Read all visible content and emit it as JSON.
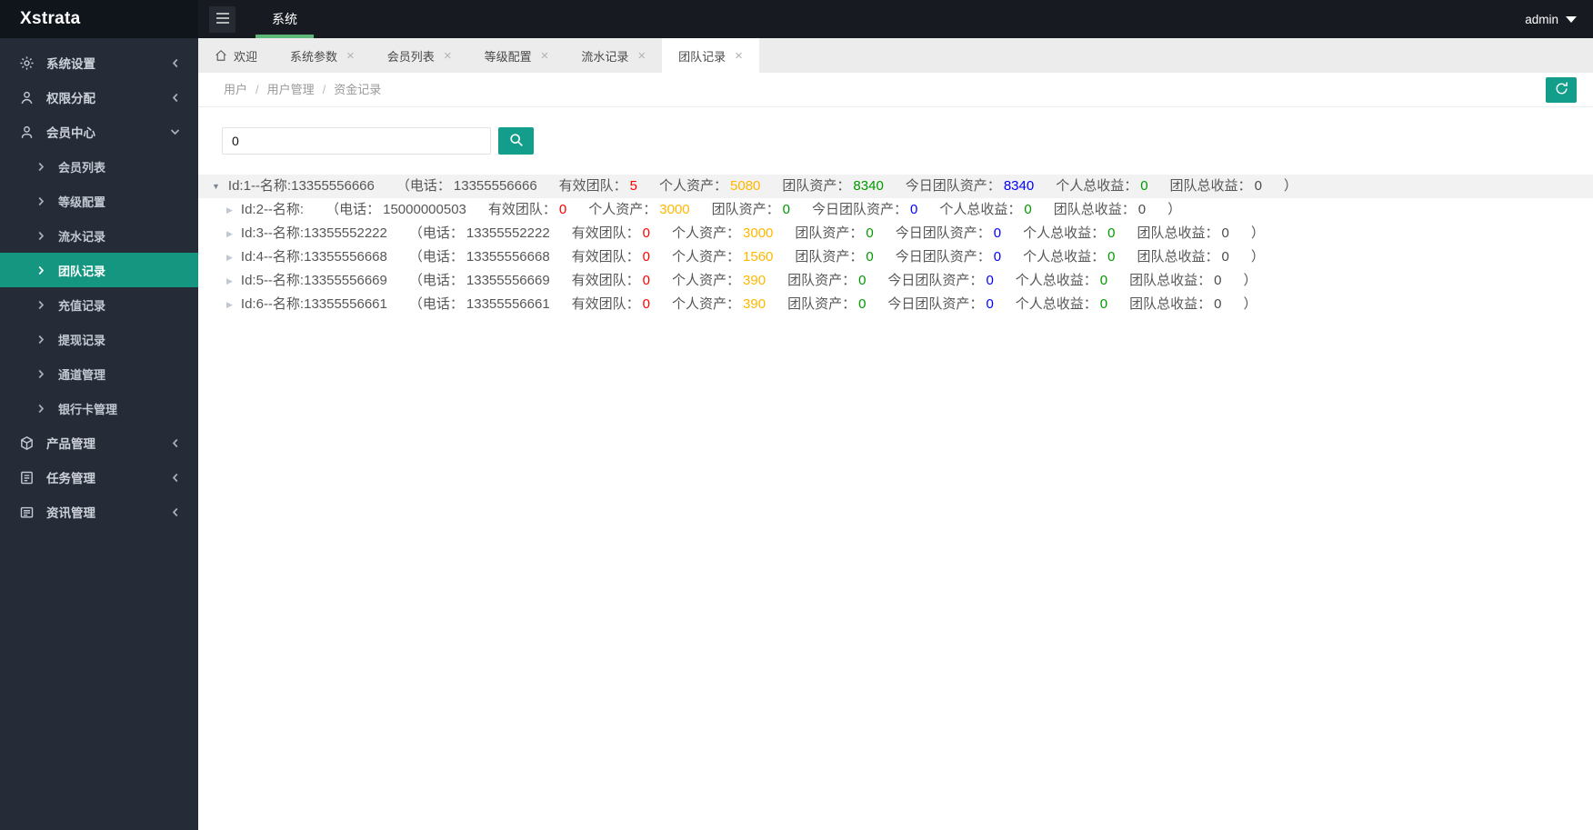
{
  "header": {
    "logo": "Xstrata",
    "nav_item": "系统",
    "user": "admin"
  },
  "colors": {
    "sidebar_bg": "#262c37",
    "accent_teal": "#129e8b",
    "sidebar_active_teal": "#149680",
    "nav_underline_green": "#5FB878",
    "value_red": "#ff0000",
    "value_orange": "#ffb800",
    "value_green": "#009900",
    "value_blue": "#0000ff"
  },
  "sidebar": {
    "items": [
      {
        "label": "系统设置",
        "icon": "gear-icon",
        "expanded": false
      },
      {
        "label": "权限分配",
        "icon": "permission-user-icon",
        "expanded": false
      },
      {
        "label": "会员中心",
        "icon": "member-user-icon",
        "expanded": true,
        "children": [
          {
            "label": "会员列表",
            "active": false
          },
          {
            "label": "等级配置",
            "active": false
          },
          {
            "label": "流水记录",
            "active": false
          },
          {
            "label": "团队记录",
            "active": true
          },
          {
            "label": "充值记录",
            "active": false
          },
          {
            "label": "提现记录",
            "active": false
          },
          {
            "label": "通道管理",
            "active": false
          },
          {
            "label": "银行卡管理",
            "active": false
          }
        ]
      },
      {
        "label": "产品管理",
        "icon": "product-icon",
        "expanded": false
      },
      {
        "label": "任务管理",
        "icon": "task-icon",
        "expanded": false
      },
      {
        "label": "资讯管理",
        "icon": "news-icon",
        "expanded": false
      }
    ]
  },
  "tabs": [
    {
      "label": "欢迎",
      "icon": "home-icon",
      "closable": false,
      "active": false
    },
    {
      "label": "系统参数",
      "closable": true,
      "active": false
    },
    {
      "label": "会员列表",
      "closable": true,
      "active": false
    },
    {
      "label": "等级配置",
      "closable": true,
      "active": false
    },
    {
      "label": "流水记录",
      "closable": true,
      "active": false
    },
    {
      "label": "团队记录",
      "closable": true,
      "active": true
    }
  ],
  "breadcrumb": {
    "items": [
      "用户",
      "用户管理",
      "资金记录"
    ],
    "separator": "/"
  },
  "toolbar": {
    "search_value": "0"
  },
  "record_labels": {
    "phone": "（电话：",
    "valid_team": "有效团队：",
    "personal_assets": "个人资产：",
    "team_assets": "团队资产：",
    "today_team_assets": "今日团队资产：",
    "personal_income": "个人总收益：",
    "team_income": "团队总收益：",
    "close_paren": "）"
  },
  "records": [
    {
      "title": "Id:1--名称:13355556666",
      "phone": "13355556666",
      "valid_team": "5",
      "personal_assets": "5080",
      "team_assets": "8340",
      "today_team_assets": "8340",
      "personal_income": "0",
      "team_income": "0",
      "expanded": true,
      "selected": true,
      "child": false
    },
    {
      "title": "Id:2--名称:",
      "phone": "15000000503",
      "valid_team": "0",
      "personal_assets": "3000",
      "team_assets": "0",
      "today_team_assets": "0",
      "personal_income": "0",
      "team_income": "0",
      "expanded": false,
      "selected": false,
      "child": true
    },
    {
      "title": "Id:3--名称:13355552222",
      "phone": "13355552222",
      "valid_team": "0",
      "personal_assets": "3000",
      "team_assets": "0",
      "today_team_assets": "0",
      "personal_income": "0",
      "team_income": "0",
      "expanded": false,
      "selected": false,
      "child": true
    },
    {
      "title": "Id:4--名称:13355556668",
      "phone": "13355556668",
      "valid_team": "0",
      "personal_assets": "1560",
      "team_assets": "0",
      "today_team_assets": "0",
      "personal_income": "0",
      "team_income": "0",
      "expanded": false,
      "selected": false,
      "child": true
    },
    {
      "title": "Id:5--名称:13355556669",
      "phone": "13355556669",
      "valid_team": "0",
      "personal_assets": "390",
      "team_assets": "0",
      "today_team_assets": "0",
      "personal_income": "0",
      "team_income": "0",
      "expanded": false,
      "selected": false,
      "child": true
    },
    {
      "title": "Id:6--名称:13355556661",
      "phone": "13355556661",
      "valid_team": "0",
      "personal_assets": "390",
      "team_assets": "0",
      "today_team_assets": "0",
      "personal_income": "0",
      "team_income": "0",
      "expanded": false,
      "selected": false,
      "child": true
    }
  ]
}
